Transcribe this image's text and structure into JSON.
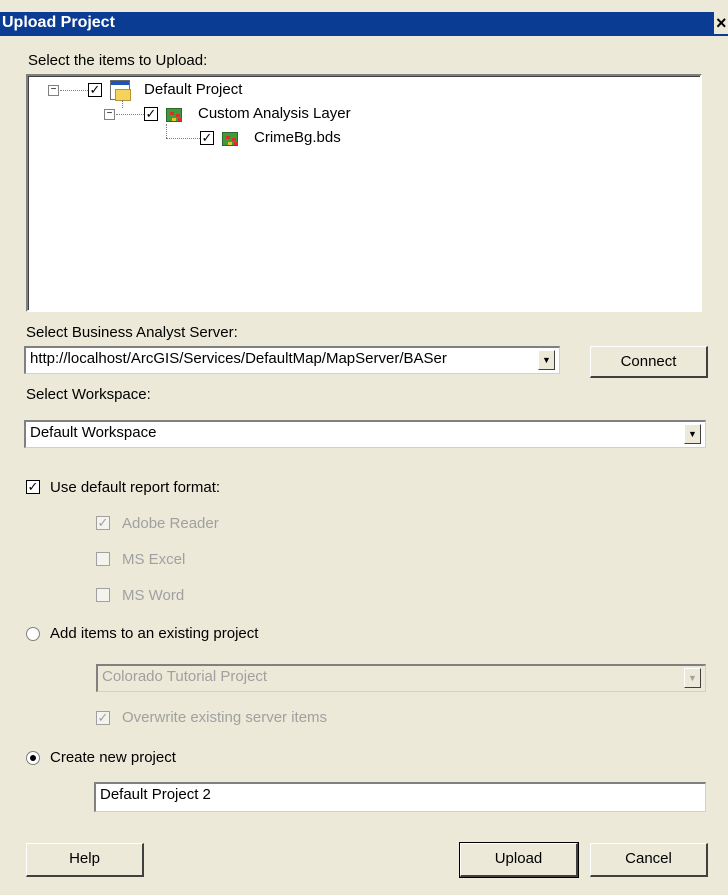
{
  "window": {
    "title": "Upload Project",
    "close_glyph": "×"
  },
  "tree": {
    "label": "Select the items to Upload:",
    "nodes": [
      {
        "label": "Default Project",
        "checked": true,
        "icon": "project-icon"
      },
      {
        "label": "Custom Analysis Layer",
        "checked": true,
        "icon": "layer-icon"
      },
      {
        "label": "CrimeBg.bds",
        "checked": true,
        "icon": "layer-icon"
      }
    ]
  },
  "server": {
    "label": "Select Business Analyst Server:",
    "value": "http://localhost/ArcGIS/Services/DefaultMap/MapServer/BASer",
    "connect_label": "Connect"
  },
  "workspace": {
    "label": "Select Workspace:",
    "value": "Default Workspace"
  },
  "report_format": {
    "label": "Use default report format:",
    "checked": true,
    "options": [
      {
        "label": "Adobe Reader",
        "checked": true
      },
      {
        "label": "MS Excel",
        "checked": false
      },
      {
        "label": "MS Word",
        "checked": false
      }
    ]
  },
  "existing_project": {
    "label": "Add items to an existing project",
    "selected": false,
    "value": "Colorado Tutorial Project",
    "overwrite_label": "Overwrite existing server items",
    "overwrite_checked": true
  },
  "new_project": {
    "label": "Create new project",
    "selected": true,
    "value": "Default Project 2"
  },
  "buttons": {
    "help": "Help",
    "upload": "Upload",
    "cancel": "Cancel"
  }
}
